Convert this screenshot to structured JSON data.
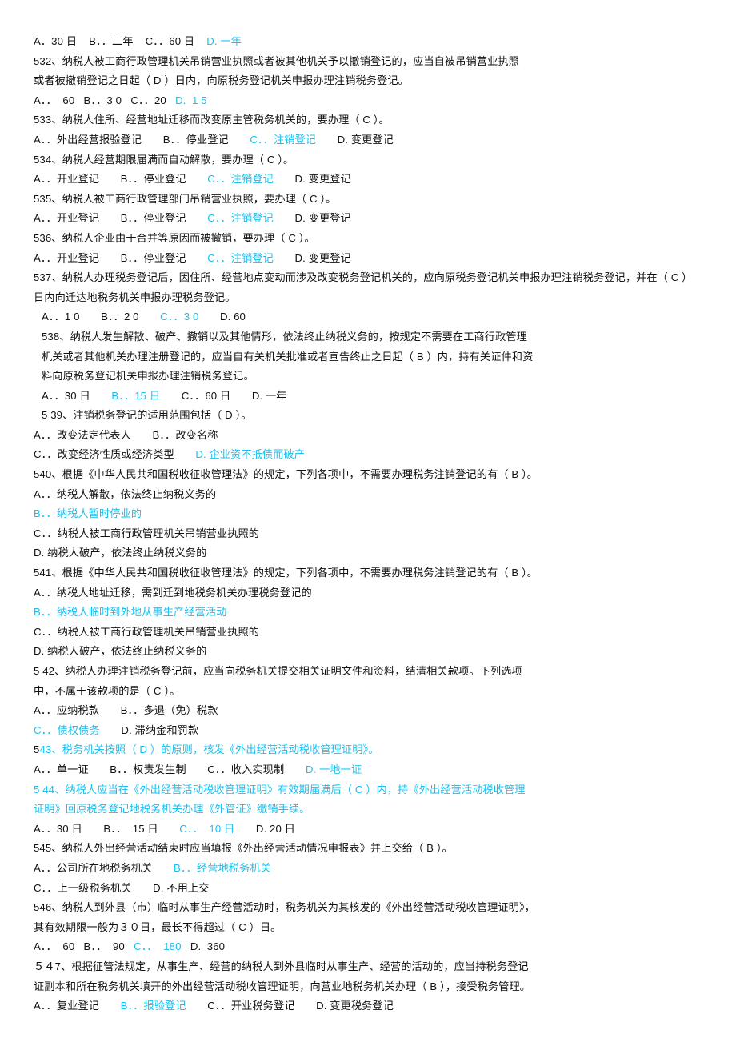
{
  "document": {
    "type": "exam-question-bank",
    "language": "zh-CN",
    "accent_color": "#18c0f0",
    "text_color": "#111111",
    "background_color": "#ffffff"
  },
  "lines": [
    {
      "id": "l001",
      "indent": 0,
      "segments": [
        {
          "text": "A．30 日    B．．二年    C．．60 日    ",
          "color": "dark"
        },
        {
          "text": "D. 一年",
          "color": "cyan"
        }
      ]
    },
    {
      "id": "l002",
      "indent": 0,
      "segments": [
        {
          "text": "532、纳税人被工商行政管理机关吊销营业执照或者被其他机关予以撤销登记的，应当自被吊销营业执照",
          "color": "dark"
        }
      ]
    },
    {
      "id": "l003",
      "indent": 0,
      "segments": [
        {
          "text": "或者被撤销登记之日起（ D ）日内，向原税务登记机关申报办理注销税务登记。",
          "color": "dark"
        }
      ]
    },
    {
      "id": "l004",
      "indent": 0,
      "segments": [
        {
          "text": "A．．  60   B．．3 0   C．．20   ",
          "color": "dark"
        },
        {
          "text": "D.  1 5",
          "color": "cyan"
        }
      ]
    },
    {
      "id": "l005",
      "indent": 0,
      "segments": [
        {
          "text": "533、纳税人住所、经营地址迁移而改变原主管税务机关的，要办理（ C ）。",
          "color": "dark"
        }
      ]
    },
    {
      "id": "l006",
      "indent": 0,
      "segments": [
        {
          "text": "A．．外出经营报验登记　　B．．停业登记　　",
          "color": "dark"
        },
        {
          "text": "C．．注销登记",
          "color": "cyan"
        },
        {
          "text": "　　D. 变更登记",
          "color": "dark"
        }
      ]
    },
    {
      "id": "l007",
      "indent": 0,
      "segments": [
        {
          "text": "534、纳税人经营期限届满而自动解散，要办理（ C ）。",
          "color": "dark"
        }
      ]
    },
    {
      "id": "l008",
      "indent": 0,
      "segments": [
        {
          "text": "A．．开业登记　　B．．停业登记　　",
          "color": "dark"
        },
        {
          "text": "C．．注销登记",
          "color": "cyan"
        },
        {
          "text": "　　D. 变更登记",
          "color": "dark"
        }
      ]
    },
    {
      "id": "l009",
      "indent": 0,
      "segments": [
        {
          "text": "535、纳税人被工商行政管理部门吊销营业执照，要办理（ C ）。",
          "color": "dark"
        }
      ]
    },
    {
      "id": "l010",
      "indent": 0,
      "segments": [
        {
          "text": "A．．开业登记　　B．．停业登记　　",
          "color": "dark"
        },
        {
          "text": "C．．注销登记",
          "color": "cyan"
        },
        {
          "text": "　　D. 变更登记",
          "color": "dark"
        }
      ]
    },
    {
      "id": "l011",
      "indent": 0,
      "segments": [
        {
          "text": "536、纳税人企业由于合并等原因而被撤销，要办理（ C ）。",
          "color": "dark"
        }
      ]
    },
    {
      "id": "l012",
      "indent": 0,
      "segments": [
        {
          "text": "A．．开业登记　　B．．停业登记　　",
          "color": "dark"
        },
        {
          "text": "C．．注销登记",
          "color": "cyan"
        },
        {
          "text": "　　D. 变更登记",
          "color": "dark"
        }
      ]
    },
    {
      "id": "l013",
      "indent": 0,
      "segments": [
        {
          "text": "537、纳税人办理税务登记后，因住所、经营地点变动而涉及改变税务登记机关的，应向原税务登记机关申报办理注销税务登记，并在（ C ）",
          "color": "dark"
        }
      ]
    },
    {
      "id": "l014",
      "indent": 0,
      "segments": [
        {
          "text": "日内向迁达地税务机关申报办理税务登记。",
          "color": "dark"
        }
      ]
    },
    {
      "id": "l015",
      "indent": 1,
      "segments": [
        {
          "text": "A．．1 0　　B．．2 0　　",
          "color": "dark"
        },
        {
          "text": "C．．3 0",
          "color": "cyan"
        },
        {
          "text": "　　D. 60",
          "color": "dark"
        }
      ]
    },
    {
      "id": "l016",
      "indent": 1,
      "segments": [
        {
          "text": "538、纳税人发生解散、破产、撤销以及其他情形，依法终止纳税义务的，按规定不需要在工商行政管理",
          "color": "dark"
        }
      ]
    },
    {
      "id": "l017",
      "indent": 1,
      "segments": [
        {
          "text": "机关或者其他机关办理注册登记的，应当自有关机关批准或者宣告终止之日起（ B ）内，持有关证件和资",
          "color": "dark"
        }
      ]
    },
    {
      "id": "l018",
      "indent": 1,
      "segments": [
        {
          "text": "料向原税务登记机关申报办理注销税务登记。",
          "color": "dark"
        }
      ]
    },
    {
      "id": "l019",
      "indent": 1,
      "segments": [
        {
          "text": "A．．30 日　　",
          "color": "dark"
        },
        {
          "text": "B．．15 日",
          "color": "cyan"
        },
        {
          "text": "　　C．．60 日　　D. 一年",
          "color": "dark"
        }
      ]
    },
    {
      "id": "l020",
      "indent": 1,
      "segments": [
        {
          "text": "5 39、注销税务登记的适用范围包括（ D ）。",
          "color": "dark"
        }
      ]
    },
    {
      "id": "l021",
      "indent": 0,
      "segments": [
        {
          "text": "A．．改变法定代表人　　B．．改变名称",
          "color": "dark"
        }
      ]
    },
    {
      "id": "l022",
      "indent": 0,
      "segments": [
        {
          "text": "C．．改变经济性质或经济类型　　",
          "color": "dark"
        },
        {
          "text": "D. 企业资不抵债而破产",
          "color": "cyan"
        }
      ]
    },
    {
      "id": "l023",
      "indent": 0,
      "segments": [
        {
          "text": "540、根据《中华人民共和国税收征收管理法》的规定，下列各项中，不需要办理税务注销登记的有（ B ）。",
          "color": "dark"
        }
      ]
    },
    {
      "id": "l024",
      "indent": 0,
      "segments": [
        {
          "text": "A．．纳税人解散，依法终止纳税义务的",
          "color": "dark"
        }
      ]
    },
    {
      "id": "l025",
      "indent": 0,
      "segments": [
        {
          "text": "B．．纳税人暂时停业的",
          "color": "cyan"
        }
      ]
    },
    {
      "id": "l026",
      "indent": 0,
      "segments": [
        {
          "text": "C．．纳税人被工商行政管理机关吊销营业执照的",
          "color": "dark"
        }
      ]
    },
    {
      "id": "l027",
      "indent": 0,
      "segments": [
        {
          "text": "D. 纳税人破产，依法终止纳税义务的",
          "color": "dark"
        }
      ]
    },
    {
      "id": "l028",
      "indent": 0,
      "segments": [
        {
          "text": "541、根据《中华人民共和国税收征收管理法》的规定，下列各项中，不需要办理税务注销登记的有（ B ）。",
          "color": "dark"
        }
      ]
    },
    {
      "id": "l029",
      "indent": 0,
      "segments": [
        {
          "text": "A．．纳税人地址迁移，需到迁到地税务机关办理税务登记的",
          "color": "dark"
        }
      ]
    },
    {
      "id": "l030",
      "indent": 0,
      "segments": [
        {
          "text": "B．．纳税人临时到外地从事生产经营活动",
          "color": "cyan"
        }
      ]
    },
    {
      "id": "l031",
      "indent": 0,
      "segments": [
        {
          "text": "C．．纳税人被工商行政管理机关吊销营业执照的",
          "color": "dark"
        }
      ]
    },
    {
      "id": "l032",
      "indent": 0,
      "segments": [
        {
          "text": "D. 纳税人破产，依法终止纳税义务的",
          "color": "dark"
        }
      ]
    },
    {
      "id": "l033",
      "indent": 0,
      "segments": [
        {
          "text": "5 42、纳税人办理注销税务登记前，应当向税务机关提交相关证明文件和资料，结清相关款项。下列选项",
          "color": "dark"
        }
      ]
    },
    {
      "id": "l034",
      "indent": 0,
      "segments": [
        {
          "text": "中，不属于该款项的是（ C ）。",
          "color": "dark"
        }
      ]
    },
    {
      "id": "l035",
      "indent": 0,
      "segments": [
        {
          "text": "A．．应纳税款　　B．．多退（免）税款",
          "color": "dark"
        }
      ]
    },
    {
      "id": "l036",
      "indent": 0,
      "segments": [
        {
          "text": "C．．债权债务",
          "color": "cyan"
        },
        {
          "text": "　　D. 滞纳金和罚款",
          "color": "dark"
        }
      ]
    },
    {
      "id": "l037",
      "indent": 0,
      "segments": [
        {
          "text": "5",
          "color": "dark"
        },
        {
          "text": "43、税务机关按照（ D ）的原则，核发《外出经营活动税收管理证明》。",
          "color": "cyan"
        }
      ]
    },
    {
      "id": "l038",
      "indent": 0,
      "segments": [
        {
          "text": "A．．单一证　　B．．权责发生制　　C．．收入实现制　　",
          "color": "dark"
        },
        {
          "text": "D. 一地一证",
          "color": "cyan"
        }
      ]
    },
    {
      "id": "l039",
      "indent": 0,
      "segments": [
        {
          "text": "5 44、纳税人应当在《外出经营活动税收管理证明》有效期届满后（ C ）内，持《外出经营活动税收管理",
          "color": "cyan"
        }
      ]
    },
    {
      "id": "l040",
      "indent": 0,
      "segments": [
        {
          "text": "证明》回原税务登记地税务机关办理《外管证》缴销手续。",
          "color": "cyan"
        }
      ]
    },
    {
      "id": "l041",
      "indent": 0,
      "segments": [
        {
          "text": "A．．30 日　　B．．  15 日　　",
          "color": "dark"
        },
        {
          "text": "C．．  10 日",
          "color": "cyan"
        },
        {
          "text": "　　D. 20 日",
          "color": "dark"
        }
      ]
    },
    {
      "id": "l042",
      "indent": 0,
      "segments": [
        {
          "text": "545、纳税人外出经营活动结束时应当填报《外出经营活动情况申报表》并上交给（ B ）。",
          "color": "dark"
        }
      ]
    },
    {
      "id": "l043",
      "indent": 0,
      "segments": [
        {
          "text": "A．．公司所在地税务机关　　",
          "color": "dark"
        },
        {
          "text": "B．．经营地税务机关",
          "color": "cyan"
        }
      ]
    },
    {
      "id": "l044",
      "indent": 0,
      "segments": [
        {
          "text": "C．．上一级税务机关　　D. 不用上交",
          "color": "dark"
        }
      ]
    },
    {
      "id": "l045",
      "indent": 0,
      "segments": [
        {
          "text": "546、纳税人到外县（市）临时从事生产经营活动时，税务机关为其核发的《外出经营活动税收管理证明》，",
          "color": "dark"
        }
      ]
    },
    {
      "id": "l046",
      "indent": 0,
      "segments": [
        {
          "text": "其有效期限一般为３０日，最长不得超过（ C ）日。",
          "color": "dark"
        }
      ]
    },
    {
      "id": "l047",
      "indent": 0,
      "segments": [
        {
          "text": "A．．  60   B．．  90   ",
          "color": "dark"
        },
        {
          "text": "C．．  180",
          "color": "cyan"
        },
        {
          "text": "   D.  360",
          "color": "dark"
        }
      ]
    },
    {
      "id": "l048",
      "indent": 0,
      "segments": [
        {
          "text": "５４7、根据征管法规定，从事生产、经营的纳税人到外县临时从事生产、经营的活动的，应当持税务登记",
          "color": "dark"
        }
      ]
    },
    {
      "id": "l049",
      "indent": 0,
      "segments": [
        {
          "text": "证副本和所在税务机关填开的外出经营活动税收管理证明，向营业地税务机关办理（ B ），接受税务管理。",
          "color": "dark"
        }
      ]
    },
    {
      "id": "l050",
      "indent": 0,
      "segments": [
        {
          "text": "A．．复业登记　　",
          "color": "dark"
        },
        {
          "text": "B．．报验登记",
          "color": "cyan"
        },
        {
          "text": "　　C．．开业税务登记　　D. 变更税务登记",
          "color": "dark"
        }
      ]
    }
  ]
}
